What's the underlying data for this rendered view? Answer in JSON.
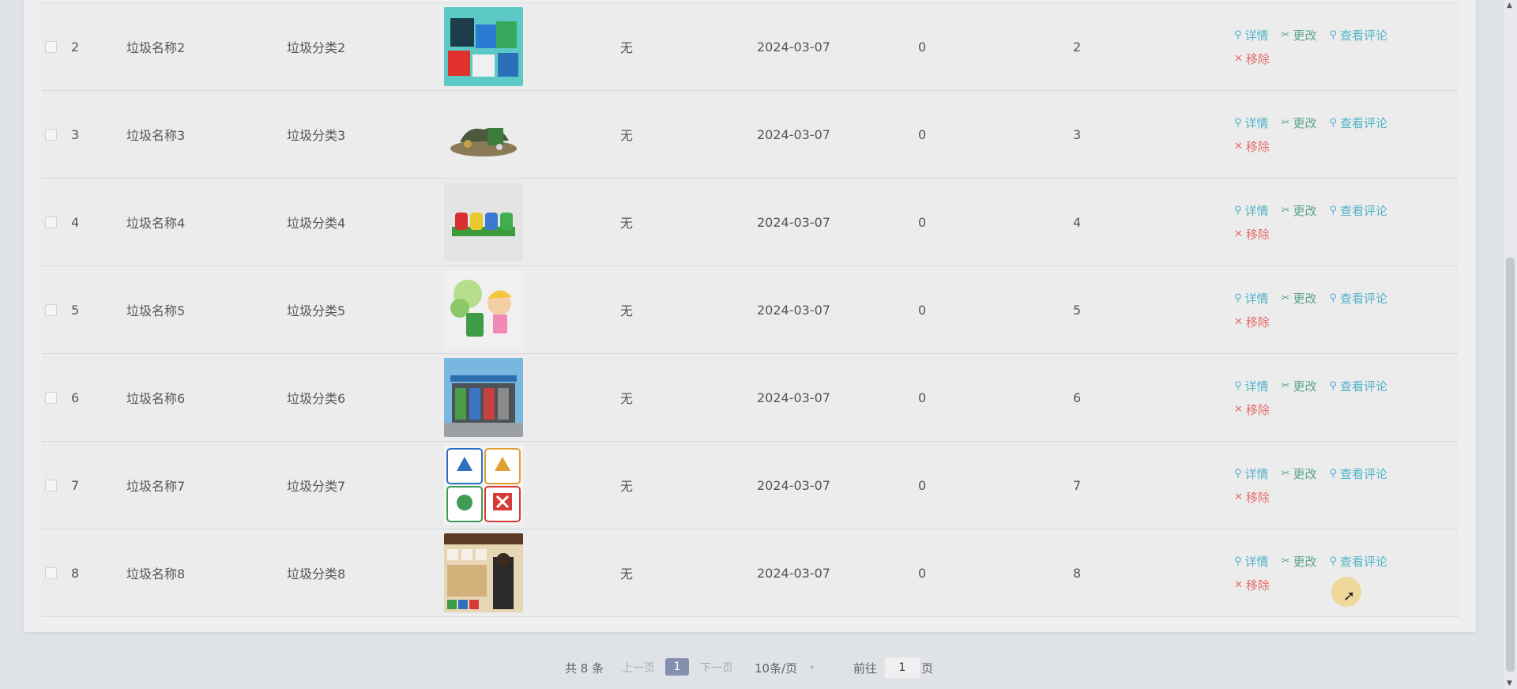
{
  "table": {
    "rows": [
      {
        "id": "2",
        "name": "垃圾名称2",
        "category": "垃圾分类2",
        "remark": "无",
        "date": "2024-03-07",
        "views": "0",
        "num": "2",
        "image": "recycling-bins-box"
      },
      {
        "id": "3",
        "name": "垃圾名称3",
        "category": "垃圾分类3",
        "remark": "无",
        "date": "2024-03-07",
        "views": "0",
        "num": "3",
        "image": "trash-pile"
      },
      {
        "id": "4",
        "name": "垃圾名称4",
        "category": "垃圾分类4",
        "remark": "无",
        "date": "2024-03-07",
        "views": "0",
        "num": "4",
        "image": "four-color-bins"
      },
      {
        "id": "5",
        "name": "垃圾名称5",
        "category": "垃圾分类5",
        "remark": "无",
        "date": "2024-03-07",
        "views": "0",
        "num": "5",
        "image": "girl-with-bin"
      },
      {
        "id": "6",
        "name": "垃圾名称6",
        "category": "垃圾分类6",
        "remark": "无",
        "date": "2024-03-07",
        "views": "0",
        "num": "6",
        "image": "sorting-station"
      },
      {
        "id": "7",
        "name": "垃圾名称7",
        "category": "垃圾分类7",
        "remark": "无",
        "date": "2024-03-07",
        "views": "0",
        "num": "7",
        "image": "four-category-signs"
      },
      {
        "id": "8",
        "name": "垃圾名称8",
        "category": "垃圾分类8",
        "remark": "无",
        "date": "2024-03-07",
        "views": "0",
        "num": "8",
        "image": "sorting-wall"
      }
    ],
    "actions": {
      "detail": "详情",
      "edit": "更改",
      "comments": "查看评论",
      "remove": "移除"
    }
  },
  "pager": {
    "total": "共 8 条",
    "prev": "上一页",
    "current_page": "1",
    "next": "下一页",
    "page_size": "10条/页",
    "goto_label": "前往",
    "goto_value": "1",
    "page_unit": "页"
  },
  "colors": {
    "accent": "#8590b0",
    "detail": "#4fb3c9",
    "edit": "#5aa58a",
    "remove": "#e56c6c"
  }
}
